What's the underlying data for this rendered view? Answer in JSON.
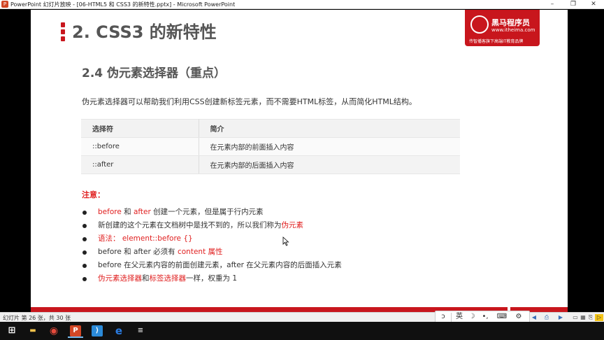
{
  "window": {
    "title": "PowerPoint 幻灯片放映 - [06-HTML5 和 CSS3 的新特性.pptx] - Microsoft PowerPoint",
    "app_icon_letter": "P",
    "minimize_glyph": "–",
    "restore_glyph": "❐",
    "close_glyph": "✕"
  },
  "slide": {
    "title": "2. CSS3 的新特性",
    "logo": {
      "name": "黑马程序员",
      "url": "www.itheima.com",
      "tagline": "传智播客旗下高端IT教育品牌",
      "glyph": "ఌ"
    },
    "heading": "2.4 伪元素选择器（重点）",
    "intro": "伪元素选择器可以帮助我们利用CSS创建新标签元素，而不需要HTML标签，从而简化HTML结构。",
    "table": {
      "headers": [
        "选择符",
        "简介"
      ],
      "rows": [
        [
          "::before",
          "在元素内部的前面插入内容"
        ],
        [
          "::after",
          "在元素内部的后面插入内容"
        ]
      ]
    },
    "note_label": "注意：",
    "bullets": [
      {
        "p1": "before",
        "p2": " 和 ",
        "p3": "after",
        "p4": " 创建一个元素，但是属于行内元素"
      },
      {
        "p1": "新创建的这个元素在文档树中是找不到的，所以我们称为",
        "p2": "伪元素"
      },
      {
        "p1": "语法：  element::before {}"
      },
      {
        "p1": "before 和 after 必须有 ",
        "p2": "content 属性"
      },
      {
        "p1": "before 在父元素内容的前面创建元素，after 在父元素内容的后面插入元素"
      },
      {
        "p1": "伪元素选择器",
        "p2": "和",
        "p3": "标签选择器",
        "p4": "一样，权重为 1"
      }
    ]
  },
  "ime": {
    "items": [
      "ↄ",
      "英",
      "☽",
      "•,",
      "⌨",
      "⚙"
    ]
  },
  "status": {
    "text": "幻灯片 第 26 张，共 30 张",
    "buttons": [
      "◀",
      "⎙",
      "▶",
      "▭",
      "▦",
      "⎘",
      "▷",
      "▢"
    ]
  },
  "taskbar": {
    "items": [
      {
        "name": "windows-start",
        "glyph": "⊞",
        "color": "#ffffff"
      },
      {
        "name": "file-explorer",
        "glyph": "▬",
        "color": "#f0c24b"
      },
      {
        "name": "chrome",
        "glyph": "◉",
        "color": "#e64a3b"
      },
      {
        "name": "powerpoint",
        "glyph": "P",
        "color": "#d24726"
      },
      {
        "name": "vscode",
        "glyph": "⟩",
        "color": "#2b8ad8"
      },
      {
        "name": "edge",
        "glyph": "e",
        "color": "#2a7be0"
      },
      {
        "name": "task-app",
        "glyph": "≡",
        "color": "#dddddd"
      }
    ]
  },
  "colors": {
    "brand_red": "#c8161d",
    "highlight_red": "#e02020"
  }
}
